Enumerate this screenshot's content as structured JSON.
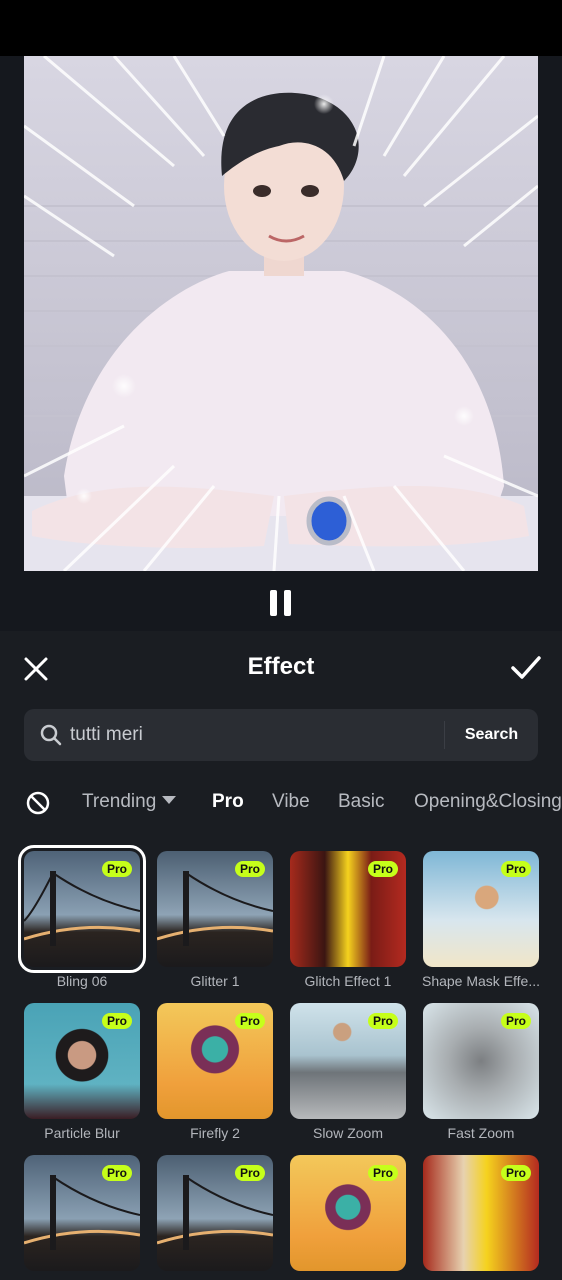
{
  "panel": {
    "title": "Effect",
    "close_icon": "close-icon",
    "confirm_icon": "check-icon"
  },
  "search": {
    "value": "tutti meri",
    "button_label": "Search",
    "icon": "search-icon"
  },
  "tabs": {
    "none_icon": "no-effect-icon",
    "items": [
      {
        "label": "Trending",
        "dropdown": true,
        "active": false
      },
      {
        "label": "Pro",
        "active": true
      },
      {
        "label": "Vibe",
        "active": false
      },
      {
        "label": "Basic",
        "active": false
      },
      {
        "label": "Opening&Closing",
        "active": false
      }
    ]
  },
  "effects": [
    {
      "label": "Bling 06",
      "badge": "Pro",
      "selected": true
    },
    {
      "label": "Glitter 1",
      "badge": "Pro"
    },
    {
      "label": "Glitch Effect 1",
      "badge": "Pro"
    },
    {
      "label": "Shape Mask Effe...",
      "badge": "Pro"
    },
    {
      "label": "Particle Blur",
      "badge": "Pro"
    },
    {
      "label": "Firefly 2",
      "badge": "Pro"
    },
    {
      "label": "Slow Zoom",
      "badge": "Pro"
    },
    {
      "label": "Fast Zoom",
      "badge": "Pro"
    },
    {
      "label": "",
      "badge": "Pro"
    },
    {
      "label": "",
      "badge": "Pro"
    },
    {
      "label": "",
      "badge": "Pro"
    },
    {
      "label": "",
      "badge": "Pro"
    }
  ],
  "colors": {
    "accent": "#c6ff1a",
    "panel_bg": "#1a1d22",
    "search_bg": "#2a2d33"
  }
}
